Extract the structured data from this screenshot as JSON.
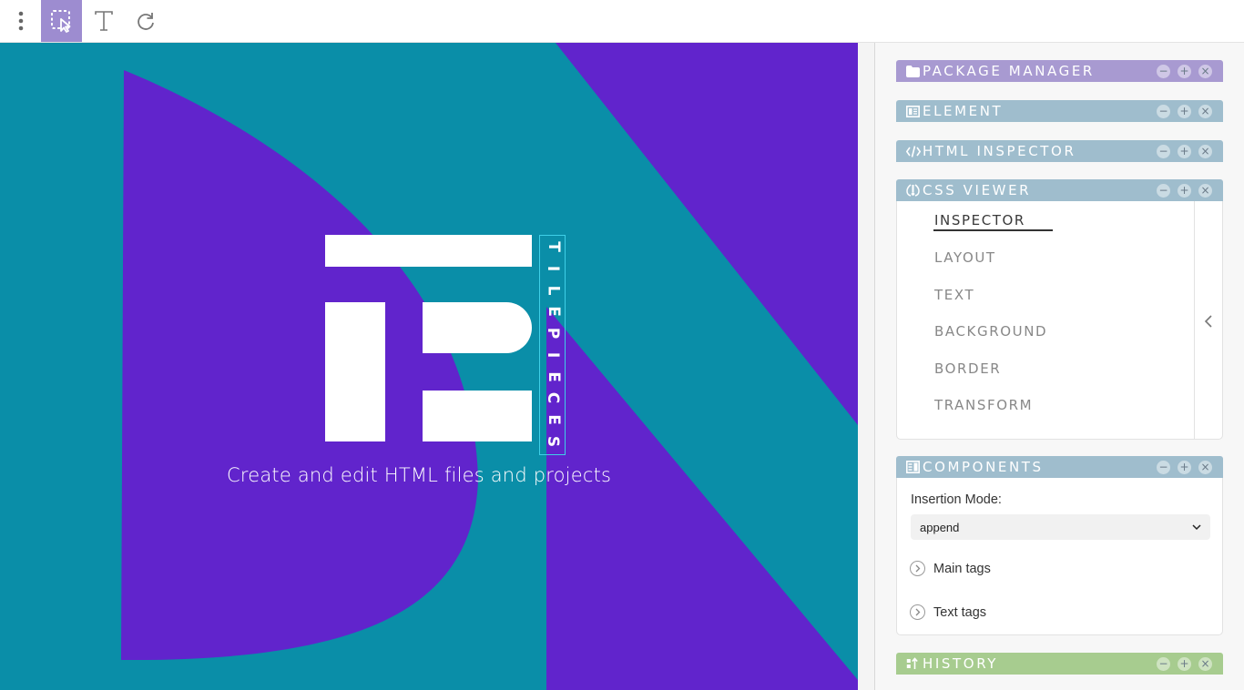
{
  "toolbar": {
    "menu_icon": "vertical-dots-icon",
    "select_icon": "select-element-icon",
    "text_icon": "text-tool-icon",
    "refresh_icon": "refresh-icon",
    "active_color": "#9d8cd0"
  },
  "canvas": {
    "bg_teal": "#0a8ea8",
    "bg_purple": "#6124cc",
    "brand_vertical": [
      "T",
      "I",
      "L",
      "E",
      "P",
      "I",
      "E",
      "C",
      "E",
      "S"
    ],
    "tagline": "Create and edit HTML files and projects"
  },
  "dock": {
    "panels": {
      "package": {
        "title": "PACKAGE MANAGER",
        "icon": "folder-icon",
        "color": "#a89ad1"
      },
      "element": {
        "title": "ELEMENT",
        "icon": "element-panel-icon",
        "color": "#9fbdcd"
      },
      "html": {
        "title": "HTML INSPECTOR",
        "icon": "code-icon",
        "color": "#9fbdcd"
      },
      "css": {
        "title": "CSS VIEWER",
        "icon": "css-brush-icon",
        "color": "#9fbdcd"
      },
      "components": {
        "title": "COMPONENTS",
        "icon": "components-icon",
        "color": "#9fbdcd"
      },
      "history": {
        "title": "HISTORY",
        "icon": "history-icon",
        "color": "#a7cc8f"
      }
    },
    "css_tabs": [
      "INSPECTOR",
      "LAYOUT",
      "TEXT",
      "BACKGROUND",
      "BORDER",
      "TRANSFORM"
    ],
    "components": {
      "insertion_label": "Insertion Mode:",
      "insertion_value": "append",
      "tree": [
        "Main tags",
        "Text tags"
      ]
    }
  }
}
